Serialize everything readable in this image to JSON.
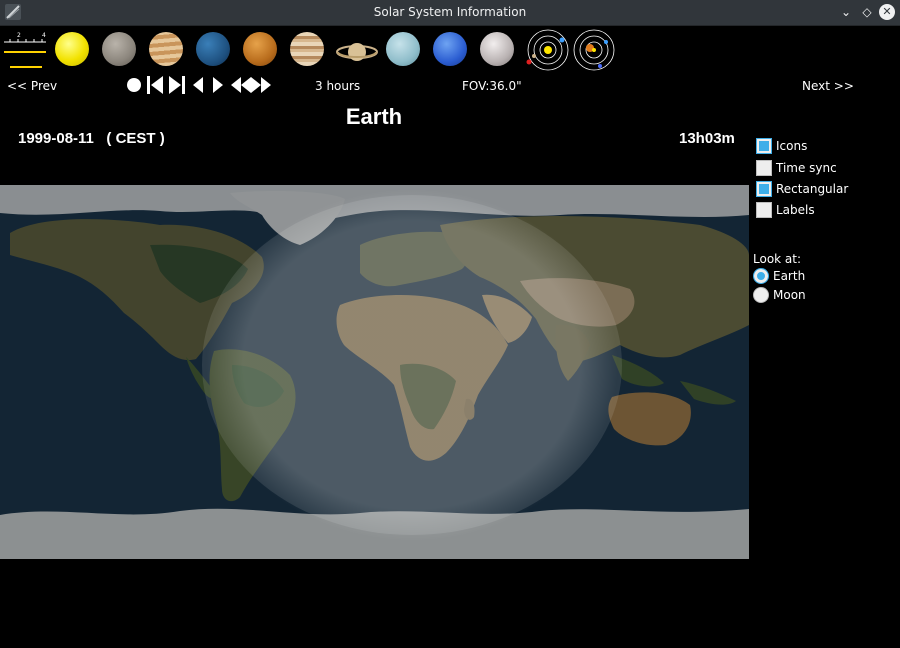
{
  "window": {
    "title": "Solar System Information"
  },
  "toolbar": {
    "scale_ticks": [
      "2",
      "4"
    ],
    "bodies": [
      {
        "name": "Sun-icon"
      },
      {
        "name": "Mercury-icon"
      },
      {
        "name": "Venus-icon"
      },
      {
        "name": "Earth-icon"
      },
      {
        "name": "Mars-icon"
      },
      {
        "name": "Jupiter-icon"
      },
      {
        "name": "Saturn-icon"
      },
      {
        "name": "Uranus-icon"
      },
      {
        "name": "Neptune-icon"
      },
      {
        "name": "Pluto-icon"
      },
      {
        "name": "inner-orbits-icon"
      },
      {
        "name": "outer-orbits-icon"
      }
    ]
  },
  "nav": {
    "prev_label": "<<  Prev",
    "next_label": "Next  >>",
    "step_label": "3 hours",
    "fov_label": "FOV:36.0\""
  },
  "header": {
    "planet": "Earth",
    "date": "1999-08-11   ( CEST )",
    "time": "13h03m"
  },
  "options": {
    "icons": {
      "label": "Icons",
      "checked": true
    },
    "time_sync": {
      "label": "Time sync",
      "checked": false
    },
    "rectangular": {
      "label": "Rectangular",
      "checked": true
    },
    "labels": {
      "label": "Labels",
      "checked": false
    }
  },
  "look_at": {
    "heading": "Look at:",
    "earth": {
      "label": "Earth",
      "selected": true
    },
    "moon": {
      "label": "Moon",
      "selected": false
    }
  }
}
